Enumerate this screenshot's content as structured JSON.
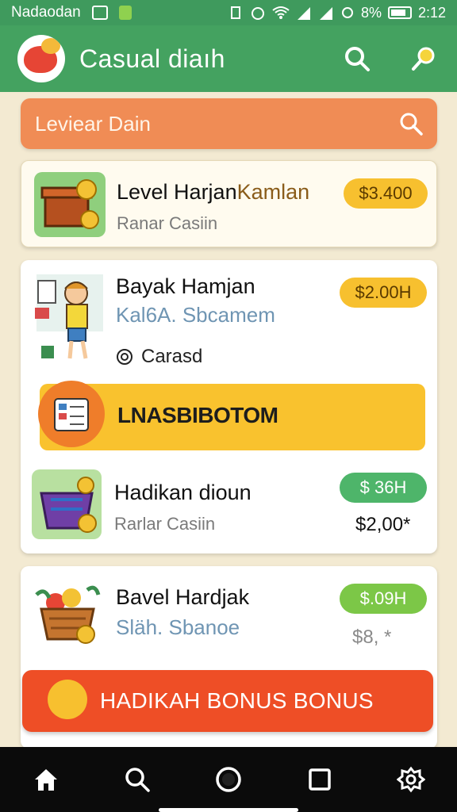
{
  "status_bar": {
    "carrier": "Nadaodan",
    "battery": "8%",
    "time": "2:12"
  },
  "app": {
    "title": "Casual diaıh"
  },
  "search": {
    "placeholder": "Leviear Dain"
  },
  "items": [
    {
      "title_main": "Level Harjan",
      "title_extra": "Kamlan",
      "subtitle": "Ranar Casiin",
      "price": "$3.400"
    },
    {
      "title_main": "Bayak Hamjan",
      "subtitle": "Kal6A. Sbcamem",
      "category": "Carasd",
      "price": "$2.00H"
    },
    {
      "title_main": "Hadikan dioun",
      "subtitle": "Rarlar Casiin",
      "price": "$ 36H",
      "amount": "$2,00*"
    },
    {
      "title_main": "Bavel Hardjak",
      "subtitle": "Släh. Sbanoe",
      "price": "$.09H",
      "amount": "$8, *"
    }
  ],
  "promo_banner": {
    "label": "LNASBIBOTOM"
  },
  "bonus_button": {
    "label": "HADIKAH BONUS BONUS"
  },
  "colors": {
    "primary": "#44a260",
    "accent": "#f08c55",
    "bonus": "#ee4e26",
    "banner": "#f9c22e"
  },
  "nav": {
    "icons": [
      "home-icon",
      "search-icon",
      "camera-icon",
      "square-icon",
      "settings-icon"
    ]
  }
}
